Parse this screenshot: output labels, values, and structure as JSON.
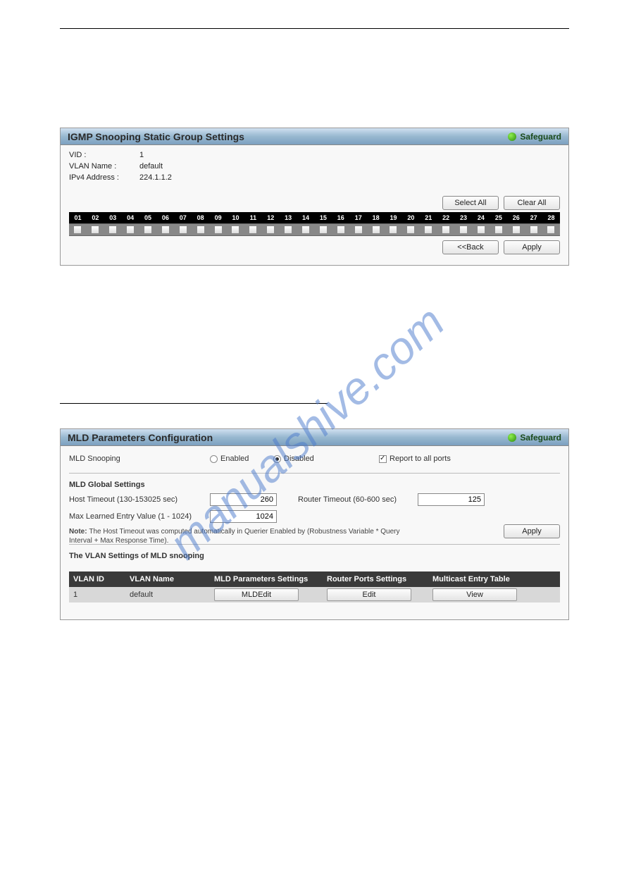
{
  "watermark_text": "manualshive.com",
  "panel1": {
    "title": "IGMP Snooping Static Group Settings",
    "safeguard": "Safeguard",
    "vid_label": "VID :",
    "vid_value": "1",
    "vlan_name_label": "VLAN Name :",
    "vlan_name_value": "default",
    "ipv4_label": "IPv4 Address :",
    "ipv4_value": "224.1.1.2",
    "select_all": "Select All",
    "clear_all": "Clear All",
    "ports": [
      "01",
      "02",
      "03",
      "04",
      "05",
      "06",
      "07",
      "08",
      "09",
      "10",
      "11",
      "12",
      "13",
      "14",
      "15",
      "16",
      "17",
      "18",
      "19",
      "20",
      "21",
      "22",
      "23",
      "24",
      "25",
      "26",
      "27",
      "28"
    ],
    "back": "<<Back",
    "apply": "Apply"
  },
  "panel2": {
    "title": "MLD Parameters Configuration",
    "safeguard": "Safeguard",
    "mld_snooping_label": "MLD Snooping",
    "enabled_label": "Enabled",
    "disabled_label": "Disabled",
    "report_label": "Report to all ports",
    "global_heading": "MLD Global Settings",
    "host_timeout_label": "Host Timeout (130-153025 sec)",
    "host_timeout_value": "260",
    "router_timeout_label": "Router Timeout (60-600 sec)",
    "router_timeout_value": "125",
    "max_learned_label": "Max Learned Entry Value (1 - 1024)",
    "max_learned_value": "1024",
    "note_prefix": "Note: ",
    "note_text": "The Host Timeout was computed automatically in Querier Enabled by (Robustness Variable * Query Interval + Max Response Time).",
    "apply": "Apply",
    "vlan_settings_heading": "The VLAN Settings of MLD snooping",
    "headers": {
      "vlan_id": "VLAN ID",
      "vlan_name": "VLAN Name",
      "mld_params": "MLD Parameters Settings",
      "router_ports": "Router Ports Settings",
      "mcast": "Multicast Entry Table"
    },
    "row": {
      "vlan_id": "1",
      "vlan_name": "default",
      "mld_btn": "MLDEdit",
      "router_btn": "Edit",
      "mcast_btn": "View"
    }
  }
}
